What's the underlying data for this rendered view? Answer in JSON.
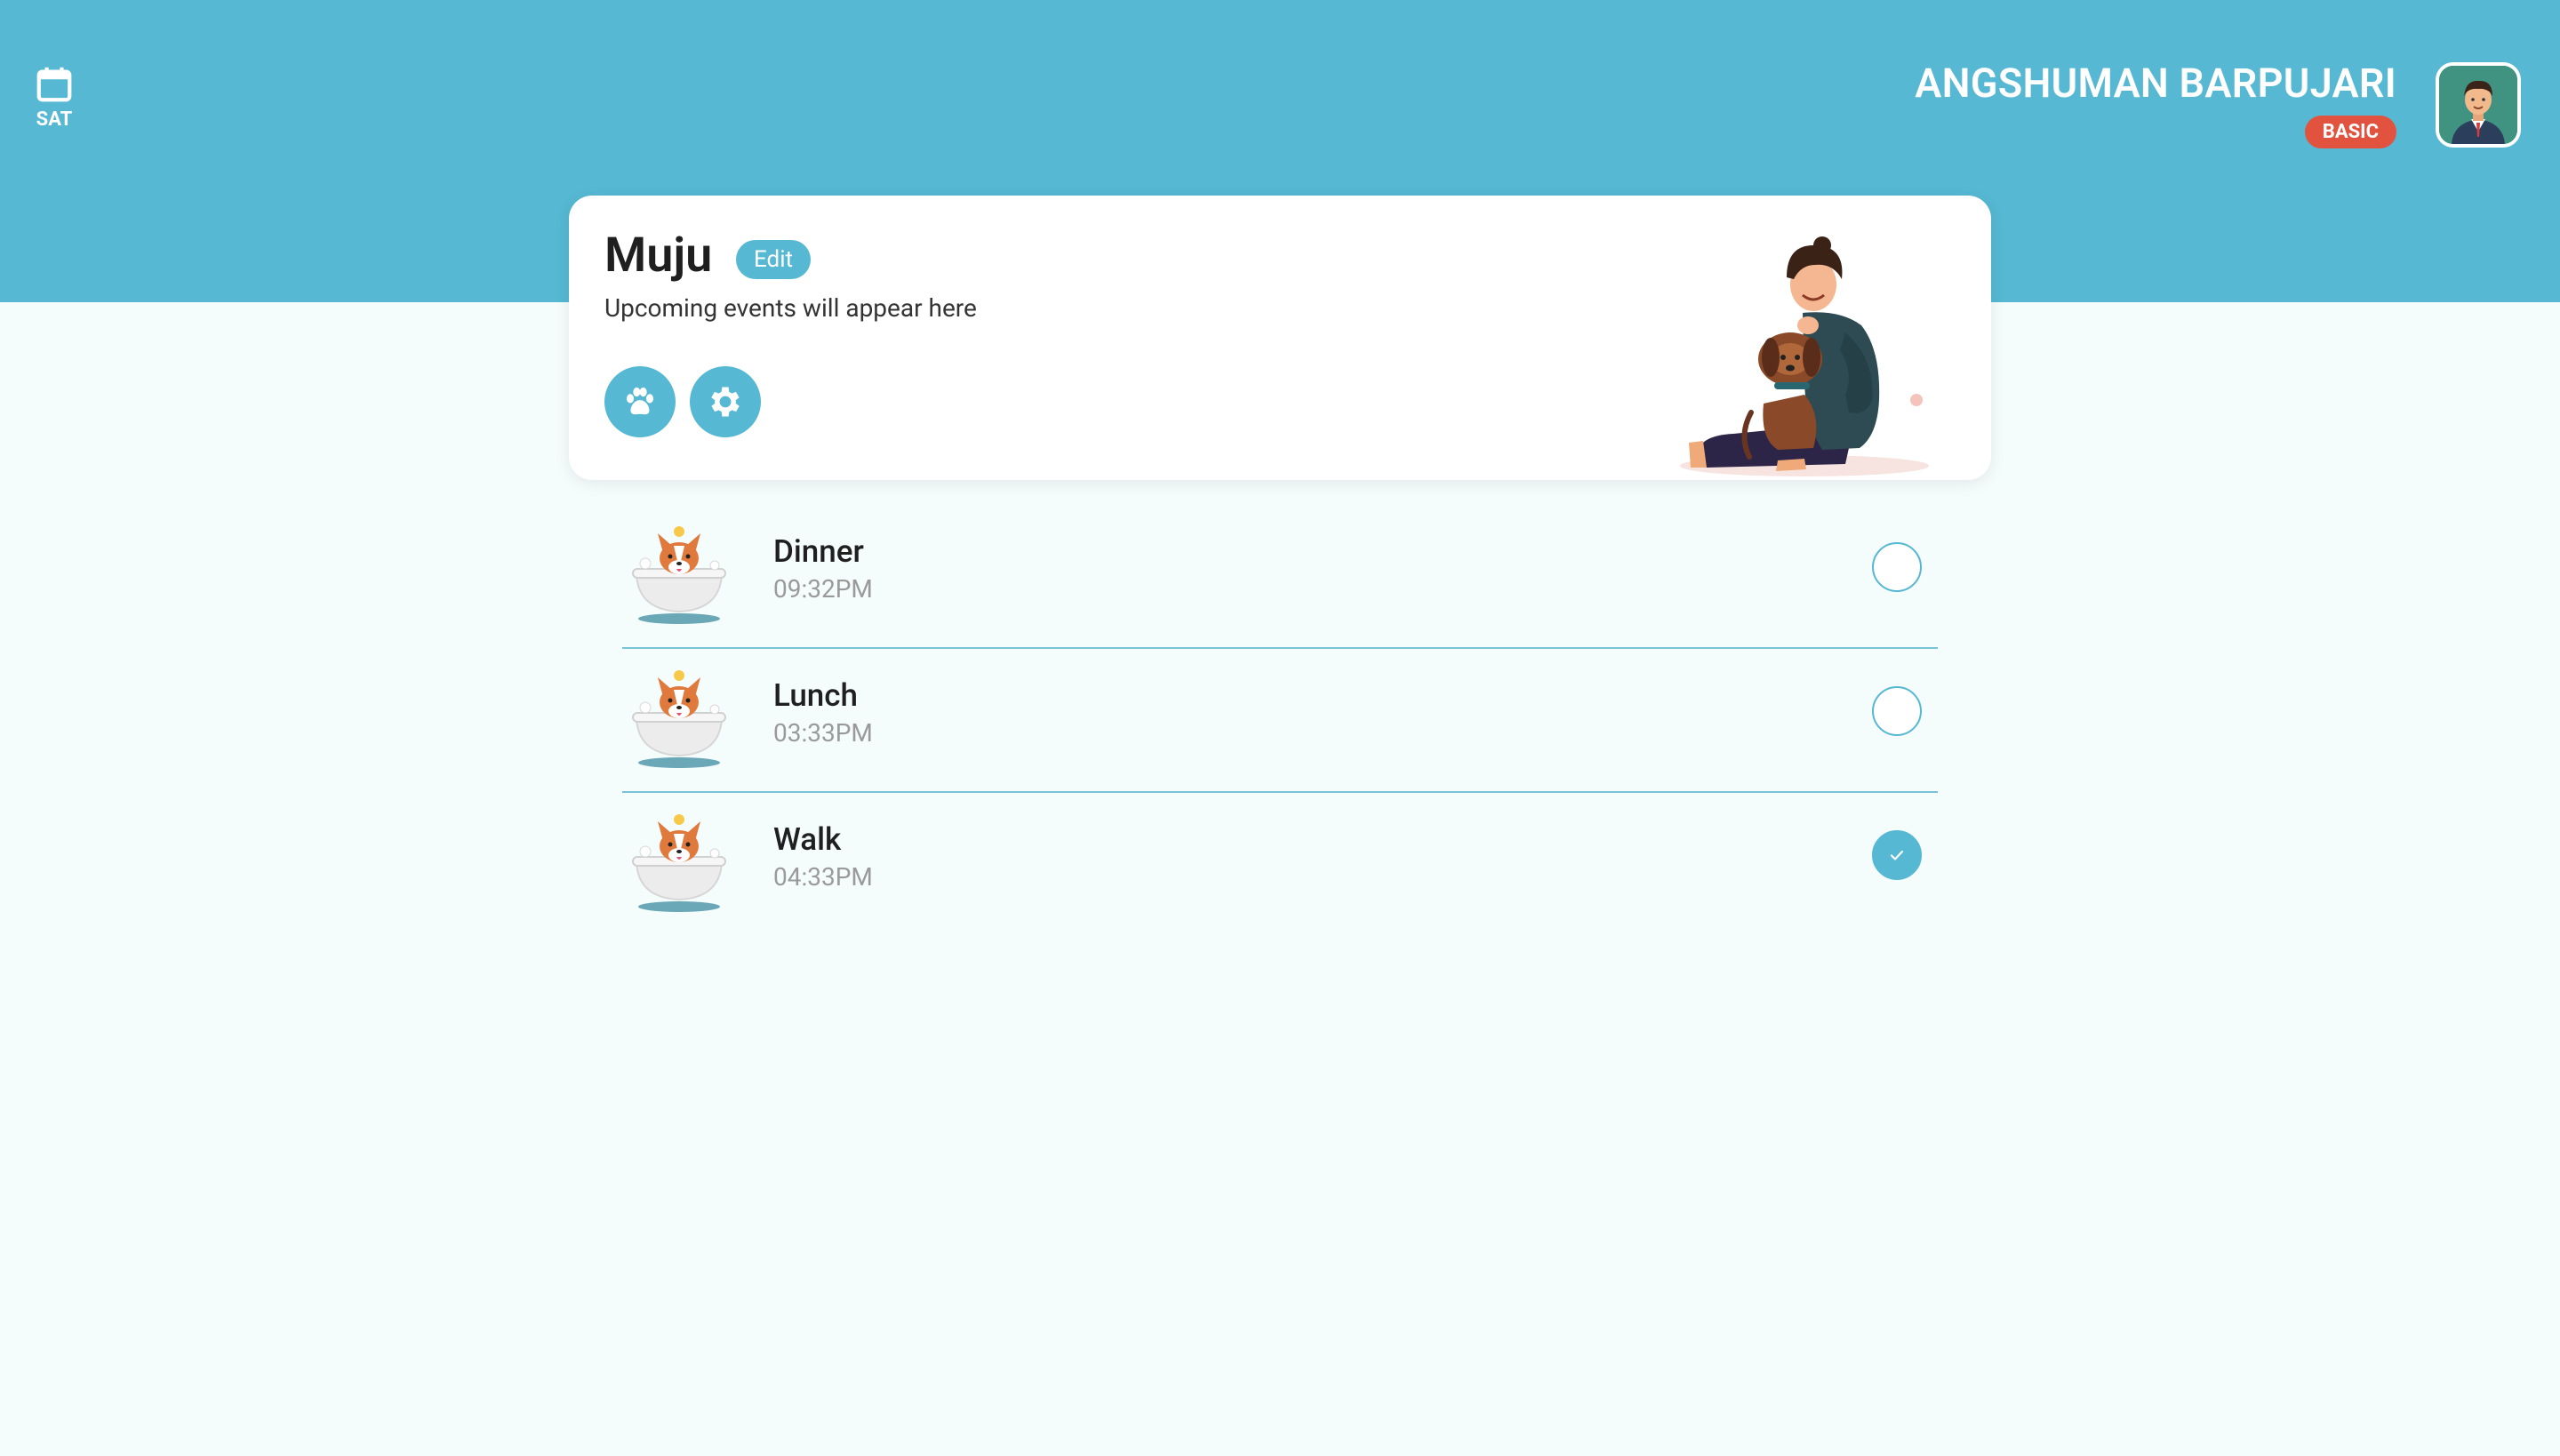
{
  "header": {
    "calendar_icon": "calendar-icon",
    "day": "SAT",
    "user_name": "ANGSHUMAN BARPUJARI",
    "plan_badge": "BASIC",
    "avatar_icon": "user-avatar",
    "colors": {
      "accent": "#56b8d3",
      "badge": "#e2533f",
      "background": "#f5fcfc"
    }
  },
  "pet_card": {
    "name": "Muju",
    "edit_label": "Edit",
    "subtitle": "Upcoming events will appear here",
    "actions": [
      {
        "icon": "paw-icon"
      },
      {
        "icon": "gear-icon"
      }
    ],
    "illustration": "person-hugging-dog-illustration"
  },
  "events": [
    {
      "title": "Dinner",
      "time": "09:32PM",
      "done": false,
      "icon": "dog-in-bathtub"
    },
    {
      "title": "Lunch",
      "time": "03:33PM",
      "done": false,
      "icon": "dog-in-bathtub"
    },
    {
      "title": "Walk",
      "time": "04:33PM",
      "done": true,
      "icon": "dog-in-bathtub"
    }
  ]
}
